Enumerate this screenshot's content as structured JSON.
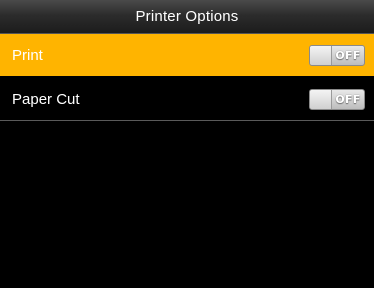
{
  "header": {
    "title": "Printer Options"
  },
  "options": [
    {
      "label": "Print",
      "state": "OFF",
      "selected": true
    },
    {
      "label": "Paper Cut",
      "state": "OFF",
      "selected": false
    }
  ],
  "colors": {
    "selected_row": "#ffb400",
    "background": "#000000",
    "title_bar": "#2c2c2c"
  },
  "icons": {
    "toggle": "toggle-switch-off-icon"
  }
}
